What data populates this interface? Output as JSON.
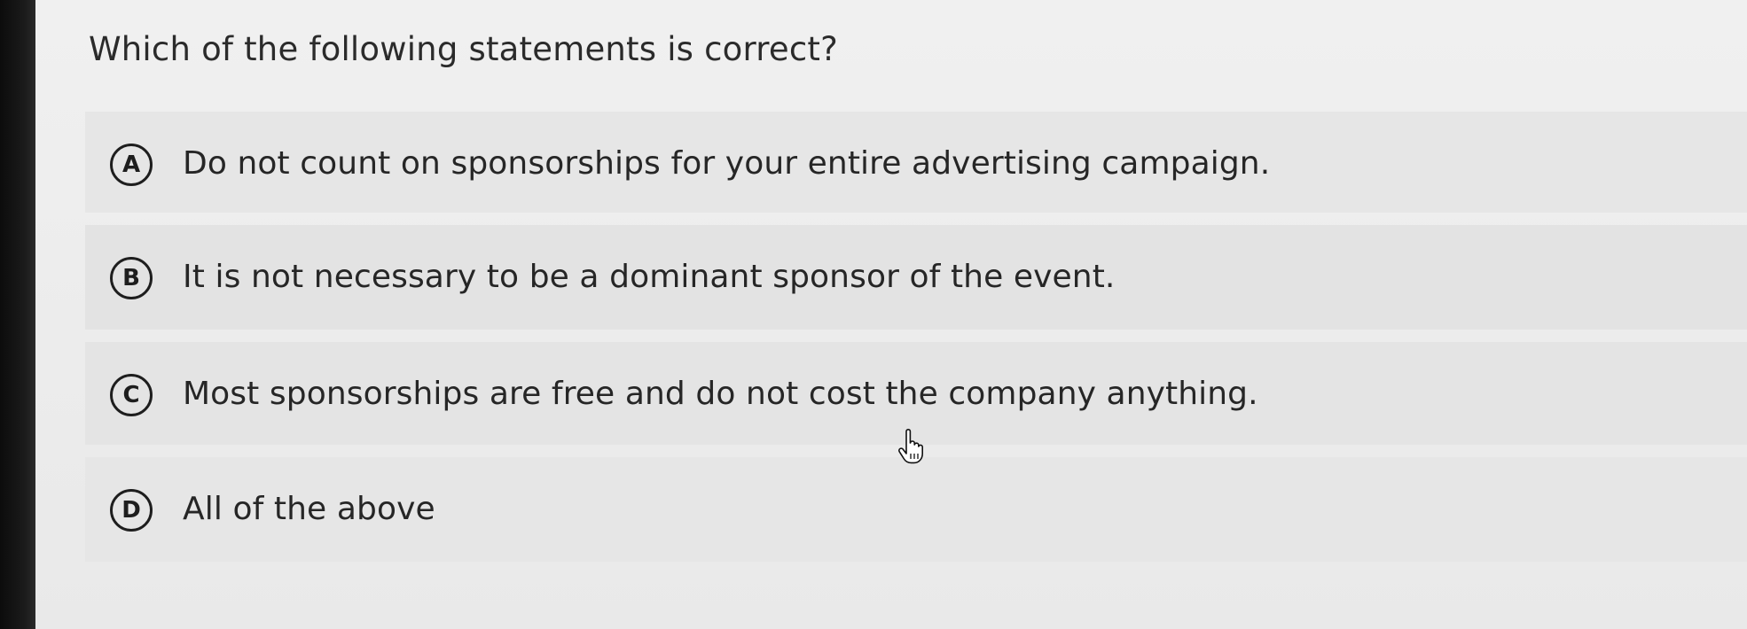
{
  "question": {
    "text": "Which of the following statements is correct?"
  },
  "options": [
    {
      "letter": "A",
      "text": "Do not count on sponsorships for your entire advertising campaign."
    },
    {
      "letter": "B",
      "text": "It is not necessary to be a dominant sponsor of the event."
    },
    {
      "letter": "C",
      "text": "Most sponsorships are free and do not cost the company anything."
    },
    {
      "letter": "D",
      "text": "All of the above"
    }
  ],
  "cursor": {
    "icon": "hand-pointer-icon"
  }
}
